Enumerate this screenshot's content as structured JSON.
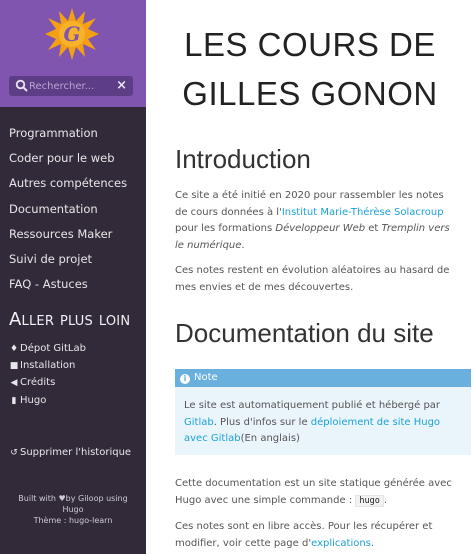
{
  "sidebar": {
    "logo_letter": "G",
    "search_placeholder": "Rechercher...",
    "clear_icon": "×",
    "menu": [
      {
        "label": "Programmation"
      },
      {
        "label": "Coder pour le web"
      },
      {
        "label": "Autres compétences"
      },
      {
        "label": "Documentation"
      },
      {
        "label": "Ressources Maker"
      },
      {
        "label": "Suivi de projet"
      },
      {
        "label": "FAQ - Astuces"
      }
    ],
    "shortcuts_title": "Aller plus loin",
    "shortcuts": [
      {
        "icon": "gitlab-icon",
        "glyph": "♦",
        "label": "Dépot GitLab"
      },
      {
        "icon": "camera-icon",
        "glyph": "■",
        "label": "Installation"
      },
      {
        "icon": "bullhorn-icon",
        "glyph": "◀",
        "label": "Crédits"
      },
      {
        "icon": "bookmark-icon",
        "glyph": "▮",
        "label": "Hugo"
      }
    ],
    "clear_history": {
      "icon": "history-icon",
      "glyph": "↺",
      "label": "Supprimer l'historique"
    },
    "footer": {
      "built_with_prefix": "Built with",
      "heart": "♥",
      "built_with_suffix": "by Giloop using",
      "hugo": "Hugo",
      "theme": "Thème : hugo-learn"
    }
  },
  "main": {
    "site_title_line1": "LES COURS DE",
    "site_title_line2": "GILLES GONON",
    "intro_heading": "Introduction",
    "intro_p1": {
      "a": "Ce site a été initié en 2020 pour rassembler les notes de cours données à l'",
      "link": "Institut Marie-Thérèse Solacroup",
      "b": " pour les formations ",
      "em1": "Développeur Web",
      "c": " et ",
      "em2": "Tremplin vers le numérique",
      "d": "."
    },
    "intro_p2": "Ces notes restent en évolution aléatoires au hasard de mes envies et de mes découvertes.",
    "doc_heading": "Documentation du site",
    "note": {
      "title": "Note",
      "a": "Le site est automatiquement publié et hébergé par ",
      "link1": "Gitlab",
      "b": ". Plus d'infos sur le ",
      "link2": "déploiement de site Hugo avec Gitlab",
      "c": "(En anglais)"
    },
    "doc_p1": {
      "a": "Cette documentation est un site statique générée avec Hugo avec une simple commande : ",
      "code": "hugo",
      "b": "."
    },
    "doc_p2": {
      "a": "Ces notes sont en libre accès. Pour les récupérer et modifier, voir cette page d'",
      "link": "explications",
      "b": "."
    }
  },
  "colors": {
    "sidebar_bg": "#322a38",
    "header_bg": "#7f55b0",
    "link": "#1da2d4",
    "note_head": "#6ab0de",
    "note_bg": "#eaf4fb"
  }
}
